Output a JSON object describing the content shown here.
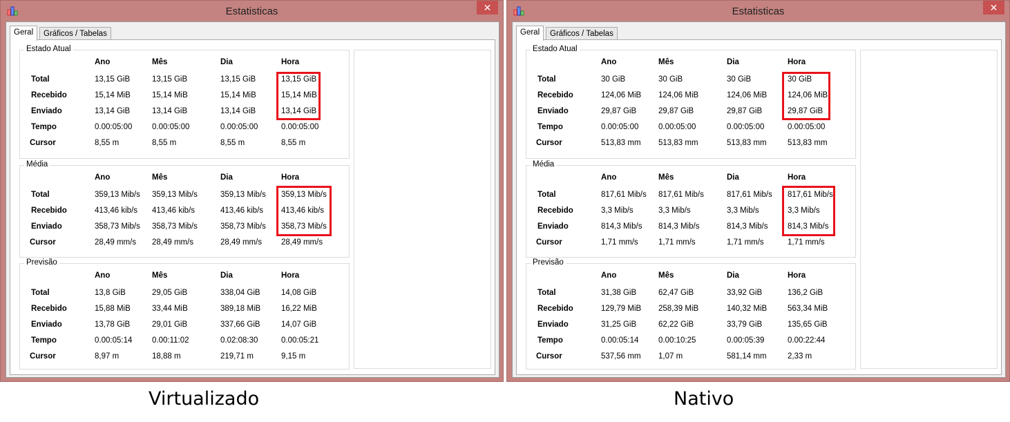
{
  "windows": [
    {
      "title": "Estatisticas",
      "close_icon": "close-icon",
      "tabs": [
        "Geral",
        "Gráficos / Tabelas"
      ],
      "columns": [
        "Ano",
        "Mês",
        "Dia",
        "Hora"
      ],
      "groups": [
        {
          "title": "Estado Atual",
          "rows": [
            {
              "label": "Total",
              "values": [
                "13,15 GiB",
                "13,15 GiB",
                "13,15 GiB",
                "13,15 GiB"
              ]
            },
            {
              "label": "Recebido",
              "values": [
                "15,14 MiB",
                "15,14 MiB",
                "15,14 MiB",
                "15,14 MiB"
              ]
            },
            {
              "label": "Enviado",
              "values": [
                "13,14 GiB",
                "13,14 GiB",
                "13,14 GiB",
                "13,14 GiB"
              ]
            },
            {
              "label": "Tempo",
              "values": [
                "0.00:05:00",
                "0.00:05:00",
                "0.00:05:00",
                "0.00:05:00"
              ]
            },
            {
              "label": "Cursor",
              "values": [
                "8,55 m",
                "8,55 m",
                "8,55 m",
                "8,55 m"
              ]
            }
          ]
        },
        {
          "title": "Média",
          "rows": [
            {
              "label": "Total",
              "values": [
                "359,13 Mib/s",
                "359,13 Mib/s",
                "359,13 Mib/s",
                "359,13 Mib/s"
              ]
            },
            {
              "label": "Recebido",
              "values": [
                "413,46 kib/s",
                "413,46 kib/s",
                "413,46 kib/s",
                "413,46 kib/s"
              ]
            },
            {
              "label": "Enviado",
              "values": [
                "358,73 Mib/s",
                "358,73 Mib/s",
                "358,73 Mib/s",
                "358,73 Mib/s"
              ]
            },
            {
              "label": "Cursor",
              "values": [
                "28,49 mm/s",
                "28,49 mm/s",
                "28,49 mm/s",
                "28,49 mm/s"
              ]
            }
          ]
        },
        {
          "title": "Previsão",
          "rows": [
            {
              "label": "Total",
              "values": [
                "13,8 GiB",
                "29,05 GiB",
                "338,04 GiB",
                "14,08 GiB"
              ]
            },
            {
              "label": "Recebido",
              "values": [
                "15,88 MiB",
                "33,44 MiB",
                "389,18 MiB",
                "16,22 MiB"
              ]
            },
            {
              "label": "Enviado",
              "values": [
                "13,78 GiB",
                "29,01 GiB",
                "337,66 GiB",
                "14,07 GiB"
              ]
            },
            {
              "label": "Tempo",
              "values": [
                "0.00:05:14",
                "0.00:11:02",
                "0.02:08:30",
                "0.00:05:21"
              ]
            },
            {
              "label": "Cursor",
              "values": [
                "8,97 m",
                "18,88 m",
                "219,71 m",
                "9,15 m"
              ]
            }
          ]
        }
      ],
      "caption": "Virtualizado"
    },
    {
      "title": "Estatisticas",
      "close_icon": "close-icon",
      "tabs": [
        "Geral",
        "Gráficos / Tabelas"
      ],
      "columns": [
        "Ano",
        "Mês",
        "Dia",
        "Hora"
      ],
      "groups": [
        {
          "title": "Estado Atual",
          "rows": [
            {
              "label": "Total",
              "values": [
                "30 GiB",
                "30 GiB",
                "30 GiB",
                "30 GiB"
              ]
            },
            {
              "label": "Recebido",
              "values": [
                "124,06 MiB",
                "124,06 MiB",
                "124,06 MiB",
                "124,06 MiB"
              ]
            },
            {
              "label": "Enviado",
              "values": [
                "29,87 GiB",
                "29,87 GiB",
                "29,87 GiB",
                "29,87 GiB"
              ]
            },
            {
              "label": "Tempo",
              "values": [
                "0.00:05:00",
                "0.00:05:00",
                "0.00:05:00",
                "0.00:05:00"
              ]
            },
            {
              "label": "Cursor",
              "values": [
                "513,83 mm",
                "513,83 mm",
                "513,83 mm",
                "513,83 mm"
              ]
            }
          ]
        },
        {
          "title": "Média",
          "rows": [
            {
              "label": "Total",
              "values": [
                "817,61 Mib/s",
                "817,61 Mib/s",
                "817,61 Mib/s",
                "817,61 Mib/s"
              ]
            },
            {
              "label": "Recebido",
              "values": [
                "3,3 Mib/s",
                "3,3 Mib/s",
                "3,3 Mib/s",
                "3,3 Mib/s"
              ]
            },
            {
              "label": "Enviado",
              "values": [
                "814,3 Mib/s",
                "814,3 Mib/s",
                "814,3 Mib/s",
                "814,3 Mib/s"
              ]
            },
            {
              "label": "Cursor",
              "values": [
                "1,71 mm/s",
                "1,71 mm/s",
                "1,71 mm/s",
                "1,71 mm/s"
              ]
            }
          ]
        },
        {
          "title": "Previsão",
          "rows": [
            {
              "label": "Total",
              "values": [
                "31,38 GiB",
                "62,47 GiB",
                "33,92 GiB",
                "136,2 GiB"
              ]
            },
            {
              "label": "Recebido",
              "values": [
                "129,79 MiB",
                "258,39 MiB",
                "140,32 MiB",
                "563,34 MiB"
              ]
            },
            {
              "label": "Enviado",
              "values": [
                "31,25 GiB",
                "62,22 GiB",
                "33,79 GiB",
                "135,65 GiB"
              ]
            },
            {
              "label": "Tempo",
              "values": [
                "0.00:05:14",
                "0.00:10:25",
                "0.00:05:39",
                "0.00:22:44"
              ]
            },
            {
              "label": "Cursor",
              "values": [
                "537,56 mm",
                "1,07 m",
                "581,14 mm",
                "2,33 m"
              ]
            }
          ]
        }
      ],
      "caption": "Nativo"
    }
  ],
  "colors": {
    "highlight": "#e8121b",
    "titlebar": "#c48380"
  }
}
